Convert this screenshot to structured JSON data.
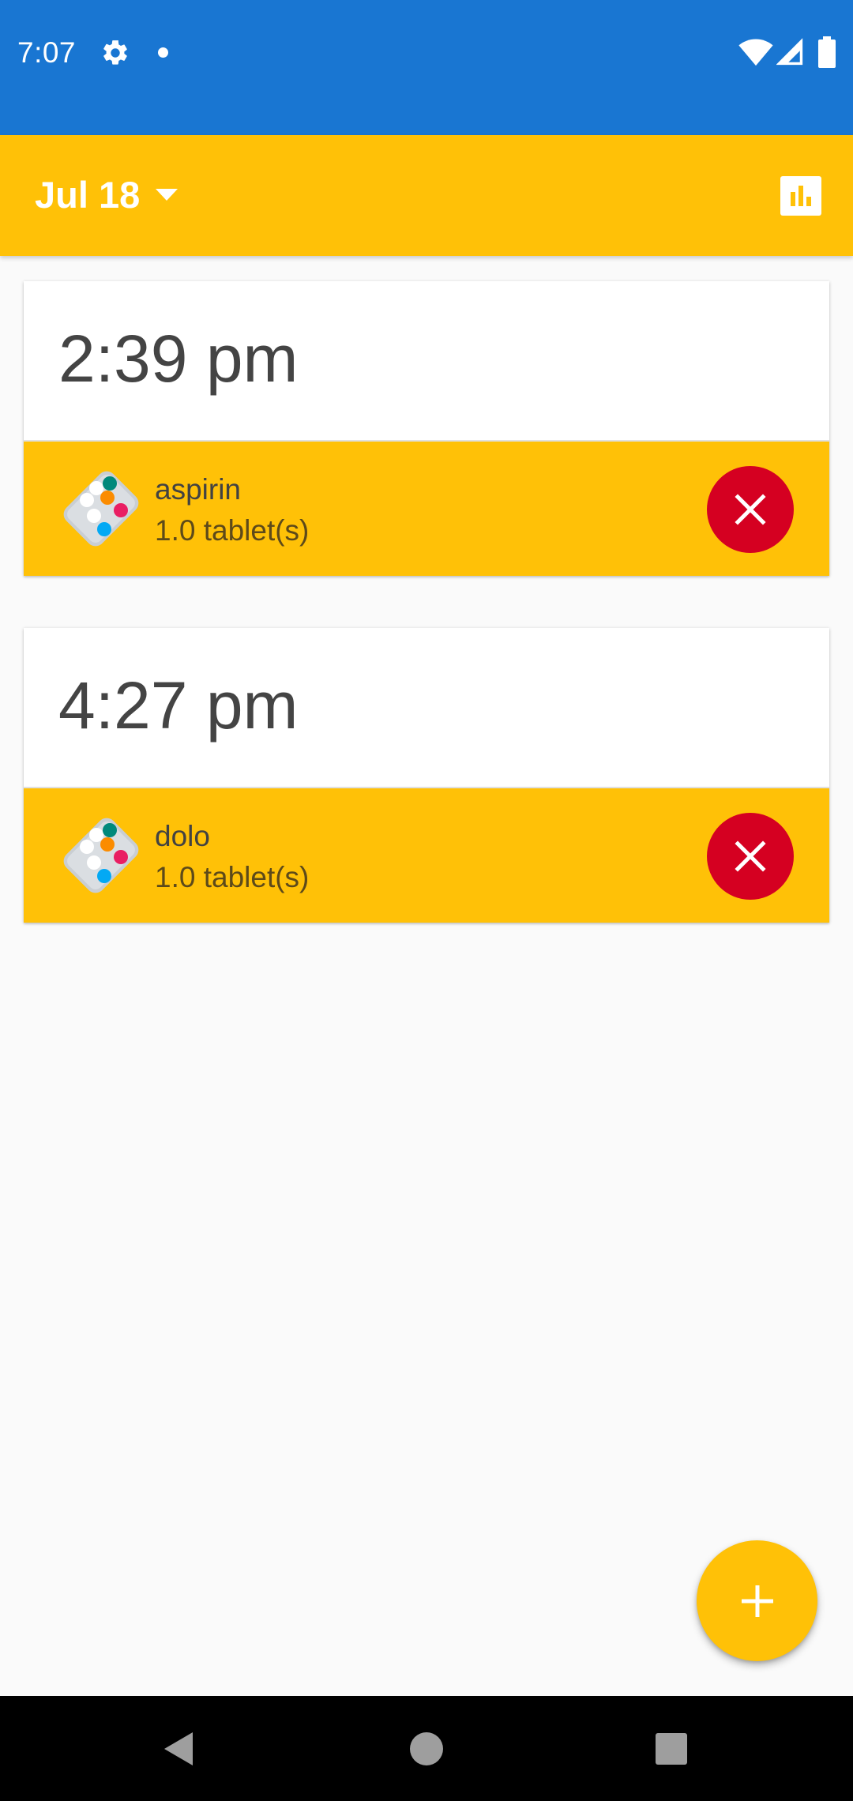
{
  "status_bar": {
    "time": "7:07",
    "icons": [
      "gear-icon",
      "notification-dot-icon",
      "wifi-icon",
      "signal-icon",
      "battery-icon"
    ],
    "background_color": "#1976D2"
  },
  "app_bar": {
    "date_label": "Jul 18",
    "dropdown_icon": "arrow-drop-down-icon",
    "stats_icon": "bar-chart-icon",
    "background_color": "#FFC107"
  },
  "schedule": [
    {
      "time": "2:39 pm",
      "medication": {
        "icon": "pill-pack-icon",
        "name": "aspirin",
        "dose": "1.0 tablet(s)"
      }
    },
    {
      "time": "4:27 pm",
      "medication": {
        "icon": "pill-pack-icon",
        "name": "dolo",
        "dose": "1.0 tablet(s)"
      }
    }
  ],
  "delete_button_color": "#D50021",
  "fab": {
    "icon": "plus-icon",
    "color": "#FFC107"
  },
  "nav_bar": {
    "icons": [
      "back-icon",
      "home-icon",
      "recents-icon"
    ]
  }
}
